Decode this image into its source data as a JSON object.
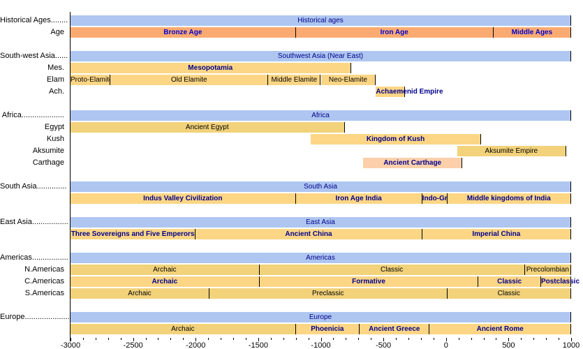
{
  "chart_data": {
    "type": "bar",
    "title": "",
    "xlabel": "",
    "ylabel": "",
    "xlim": [
      -3000,
      1000
    ],
    "x_ticks": [
      -3000,
      -2500,
      -2000,
      -1500,
      -1000,
      -500,
      0,
      500,
      1000
    ],
    "x_tick_labels": [
      "-3000",
      "-2500",
      "-2000",
      "-1500",
      "-1000",
      "-500",
      "0",
      "500",
      "1000"
    ],
    "grid": false,
    "legend": "none",
    "orientation": "horizontal-timeline",
    "colors": {
      "group_band": "#aec6f0",
      "age_band": "#fbab72",
      "period_band": "#fcd685",
      "period_band_alt": "#f2d27a",
      "period_band_light": "#fcd0ab",
      "label_blue": "#00008b",
      "label_black": "#000000",
      "border": "#000000"
    },
    "rows": [
      {
        "label": "Historical Ages........",
        "kind": "group",
        "bars": [
          {
            "text": "Historical ages",
            "start": -3000,
            "end": 1000,
            "style": "group"
          }
        ]
      },
      {
        "label": "Age",
        "kind": "series",
        "bars": [
          {
            "text": "Bronze Age",
            "start": -3000,
            "end": -1200,
            "style": "orange"
          },
          {
            "text": "Iron Age",
            "start": -1200,
            "end": 380,
            "style": "orange"
          },
          {
            "text": "Middle Ages",
            "start": 380,
            "end": 1000,
            "style": "orange"
          }
        ]
      },
      {
        "label": "",
        "kind": "spacer",
        "bars": []
      },
      {
        "label": "South-west Asia......",
        "kind": "group",
        "bars": [
          {
            "text": "Southwest Asia (Near East)",
            "start": -3000,
            "end": 1000,
            "style": "group"
          }
        ]
      },
      {
        "label": "Mes.",
        "kind": "series",
        "bars": [
          {
            "text": "Mesopotamia",
            "start": -3000,
            "end": -760,
            "style": "yellow"
          }
        ]
      },
      {
        "label": "Elam",
        "kind": "series",
        "bars": [
          {
            "text": "Proto-Elamite",
            "start": -3000,
            "end": -2680,
            "style": "pale"
          },
          {
            "text": "Old Elamite",
            "start": -2680,
            "end": -1420,
            "style": "pale"
          },
          {
            "text": "Middle Elamite",
            "start": -1420,
            "end": -1000,
            "style": "pale"
          },
          {
            "text": "Neo-Elamite",
            "start": -1000,
            "end": -560,
            "style": "pale"
          }
        ]
      },
      {
        "label": "Ach.",
        "kind": "series",
        "bars": [
          {
            "text": "Achaemenid Empire",
            "start": -560,
            "end": -330,
            "style": "yellow"
          }
        ]
      },
      {
        "label": "",
        "kind": "spacer",
        "bars": []
      },
      {
        "label": "Africa....................",
        "kind": "group",
        "bars": [
          {
            "text": "Africa",
            "start": -3000,
            "end": 1000,
            "style": "group"
          }
        ]
      },
      {
        "label": "Egypt",
        "kind": "series",
        "bars": [
          {
            "text": "Ancient Egypt",
            "start": -3000,
            "end": -810,
            "style": "yellowdark"
          }
        ]
      },
      {
        "label": "Kush",
        "kind": "series",
        "bars": [
          {
            "text": "Kingdom of Kush",
            "start": -1080,
            "end": 280,
            "style": "yellow"
          }
        ]
      },
      {
        "label": "Aksumite",
        "kind": "series",
        "bars": [
          {
            "text": "Aksumite Empire",
            "start": 90,
            "end": 960,
            "style": "yellowdark"
          }
        ]
      },
      {
        "label": "Carthage",
        "kind": "series",
        "bars": [
          {
            "text": "Ancient Carthage",
            "start": -660,
            "end": 130,
            "style": "peach"
          }
        ]
      },
      {
        "label": "",
        "kind": "spacer",
        "bars": []
      },
      {
        "label": "South Asia..............",
        "kind": "group",
        "bars": [
          {
            "text": "South Asia",
            "start": -3000,
            "end": 1000,
            "style": "group"
          }
        ]
      },
      {
        "label": "",
        "kind": "series",
        "bars": [
          {
            "text": "Indus Valley Civilization",
            "start": -3000,
            "end": -1200,
            "style": "yellow"
          },
          {
            "text": "Iron Age India",
            "start": -1200,
            "end": -190,
            "style": "yellow"
          },
          {
            "text": "Indo-Greeks",
            "start": -190,
            "end": 10,
            "style": "yellow"
          },
          {
            "text": "Middle kingdoms of India",
            "start": 10,
            "end": 1000,
            "style": "yellow"
          }
        ]
      },
      {
        "label": "",
        "kind": "spacer",
        "bars": []
      },
      {
        "label": "East Asia.................",
        "kind": "group",
        "bars": [
          {
            "text": "East Asia",
            "start": -3000,
            "end": 1000,
            "style": "group"
          }
        ]
      },
      {
        "label": "",
        "kind": "series",
        "bars": [
          {
            "text": "Three Sovereigns and Five Emperors",
            "start": -3000,
            "end": -2000,
            "style": "yellow"
          },
          {
            "text": "Ancient China",
            "start": -2000,
            "end": -190,
            "style": "yellow"
          },
          {
            "text": "Imperial China",
            "start": -190,
            "end": 1000,
            "style": "yellow"
          }
        ]
      },
      {
        "label": "",
        "kind": "spacer",
        "bars": []
      },
      {
        "label": "Americas.................",
        "kind": "group",
        "bars": [
          {
            "text": "Americas",
            "start": -3000,
            "end": 1000,
            "style": "group"
          }
        ]
      },
      {
        "label": "N.Americas",
        "kind": "series",
        "bars": [
          {
            "text": "Archaic",
            "start": -3000,
            "end": -1490,
            "style": "yellowdark"
          },
          {
            "text": "Classic",
            "start": -1490,
            "end": 630,
            "style": "yellowdark"
          },
          {
            "text": "Precolombian",
            "start": 630,
            "end": 1000,
            "style": "yellowdark"
          }
        ]
      },
      {
        "label": "C.Americas",
        "kind": "series",
        "bars": [
          {
            "text": "Archaic",
            "start": -3000,
            "end": -1490,
            "style": "yellow"
          },
          {
            "text": "Formative",
            "start": -1490,
            "end": 260,
            "style": "yellow"
          },
          {
            "text": "Classic",
            "start": 260,
            "end": 760,
            "style": "yellow"
          },
          {
            "text": "Postclassic",
            "start": 760,
            "end": 1000,
            "style": "yellow"
          }
        ]
      },
      {
        "label": "S.Americas",
        "kind": "series",
        "bars": [
          {
            "text": "Archaic",
            "start": -3000,
            "end": -1890,
            "style": "yellowdark"
          },
          {
            "text": "Preclassic",
            "start": -1890,
            "end": 10,
            "style": "yellowdark"
          },
          {
            "text": "Classic",
            "start": 10,
            "end": 1000,
            "style": "yellowdark"
          }
        ]
      },
      {
        "label": "",
        "kind": "spacer",
        "bars": []
      },
      {
        "label": "Europe.....................",
        "kind": "group",
        "bars": [
          {
            "text": "Europe",
            "start": -3000,
            "end": 1000,
            "style": "group"
          }
        ]
      },
      {
        "label": "",
        "kind": "series",
        "bars": [
          {
            "text": "Archaic",
            "start": -3000,
            "end": -1200,
            "style": "yellowdark"
          },
          {
            "text": "Phoenicia",
            "start": -1200,
            "end": -690,
            "style": "yellow"
          },
          {
            "text": "Ancient Greece",
            "start": -690,
            "end": -130,
            "style": "yellow"
          },
          {
            "text": "Ancient Rome",
            "start": -130,
            "end": 1000,
            "style": "yellow"
          }
        ]
      }
    ]
  }
}
